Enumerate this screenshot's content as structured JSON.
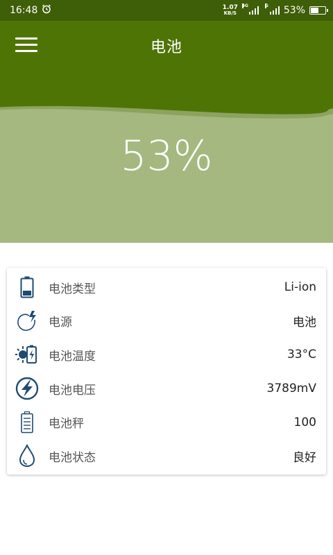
{
  "status_bar": {
    "time": "16:48",
    "net_speed": "1.07",
    "net_unit": "KB/S",
    "signal1_tag": "4G",
    "signal2_tag": "G",
    "battery_text": "53%",
    "battery_level": 0.53
  },
  "header": {
    "title": "电池",
    "menu_icon": "hamburger-menu-icon"
  },
  "hero": {
    "percent_text": "53%",
    "level": 0.53
  },
  "colors": {
    "statusbar": "#3f5e08",
    "header": "#4e7406",
    "wave": "#a5b87f",
    "icon": "#1f4a73"
  },
  "info_rows": [
    {
      "icon": "battery-icon",
      "label": "电池类型",
      "value": "Li-ion"
    },
    {
      "icon": "power-source-icon",
      "label": "电源",
      "value": "电池"
    },
    {
      "icon": "temperature-icon",
      "label": "电池温度",
      "value": "33°C"
    },
    {
      "icon": "voltage-icon",
      "label": "电池电压",
      "value": "3789mV"
    },
    {
      "icon": "battery-scale-icon",
      "label": "电池秤",
      "value": "100"
    },
    {
      "icon": "status-drop-icon",
      "label": "电池状态",
      "value": "良好"
    }
  ]
}
